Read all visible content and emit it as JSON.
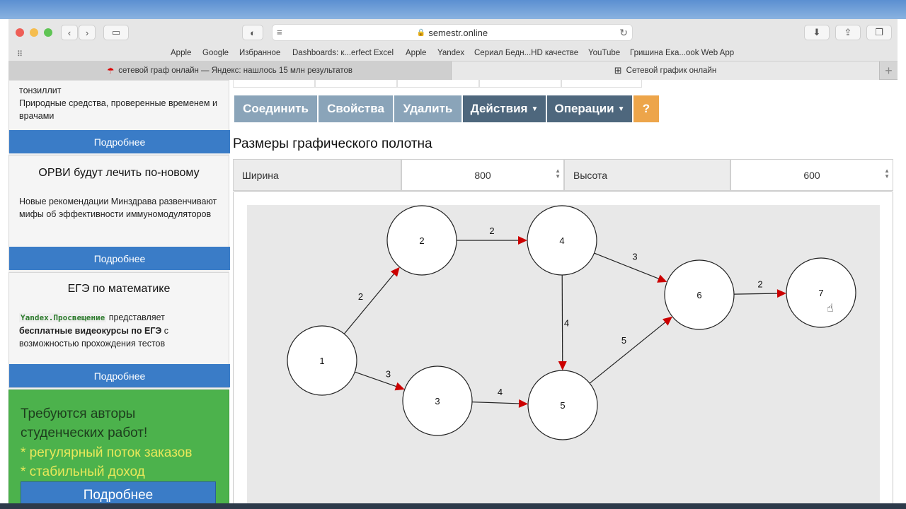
{
  "browser": {
    "url": "semestr.online",
    "bookmarks": [
      "Apple",
      "Google",
      "Избранное",
      "Dashboards: к...erfect Excel",
      "Apple",
      "Yandex",
      "Сериал Бедн...HD качестве",
      "YouTube",
      "Гришина Ека...ook Web App"
    ],
    "tabs": [
      {
        "label": "сетевой граф онлайн — Яндекс: нашлось 15 млн результатов",
        "active": false
      },
      {
        "label": "Сетевой график онлайн",
        "active": true
      }
    ]
  },
  "sidebar": {
    "card1": {
      "text_line1": "тонзиллит",
      "text_rest": "Природные средства, проверенные временем и врачами",
      "more": "Подробнее"
    },
    "card2": {
      "title": "ОРВИ будут лечить по-новому",
      "text": "Новые рекомендации Минздрава развенчивают мифы об эффективности иммуномодуляторов",
      "more": "Подробнее"
    },
    "card3": {
      "title": "ЕГЭ по математике",
      "brand": "Yandex.Просвещение",
      "text_a": " представляет ",
      "text_bold": "бесплатные видеокурсы по ЕГЭ",
      "text_b": " с возможностью прохождения тестов",
      "more": "Подробнее"
    },
    "promo": {
      "line1": "Требуются авторы",
      "line2": "студенческих работ!",
      "line3": "* регулярный поток заказов",
      "line4": "* стабильный доход",
      "button": "Подробнее"
    }
  },
  "toolbar": {
    "connect": "Соединить",
    "properties": "Свойства",
    "delete": "Удалить",
    "actions": "Действия",
    "operations": "Операции",
    "help": "?"
  },
  "canvas_size": {
    "title": "Размеры графического полотна",
    "width_label": "Ширина",
    "width_value": "800",
    "height_label": "Высота",
    "height_value": "600"
  },
  "graph": {
    "nodes": [
      {
        "id": "1",
        "label": "1"
      },
      {
        "id": "2",
        "label": "2"
      },
      {
        "id": "3",
        "label": "3"
      },
      {
        "id": "4",
        "label": "4"
      },
      {
        "id": "5",
        "label": "5"
      },
      {
        "id": "6",
        "label": "6"
      },
      {
        "id": "7",
        "label": "7"
      }
    ],
    "edges": [
      {
        "from": "1",
        "to": "2",
        "weight": "2"
      },
      {
        "from": "1",
        "to": "3",
        "weight": "3"
      },
      {
        "from": "2",
        "to": "4",
        "weight": "2"
      },
      {
        "from": "3",
        "to": "5",
        "weight": "4"
      },
      {
        "from": "4",
        "to": "5",
        "weight": "4"
      },
      {
        "from": "4",
        "to": "6",
        "weight": "3"
      },
      {
        "from": "5",
        "to": "6",
        "weight": "5"
      },
      {
        "from": "6",
        "to": "7",
        "weight": "2"
      }
    ],
    "colors": {
      "arrow": "#cc0000",
      "node_fill": "#ffffff",
      "node_stroke": "#222222",
      "canvas": "#e8e8e8"
    }
  }
}
